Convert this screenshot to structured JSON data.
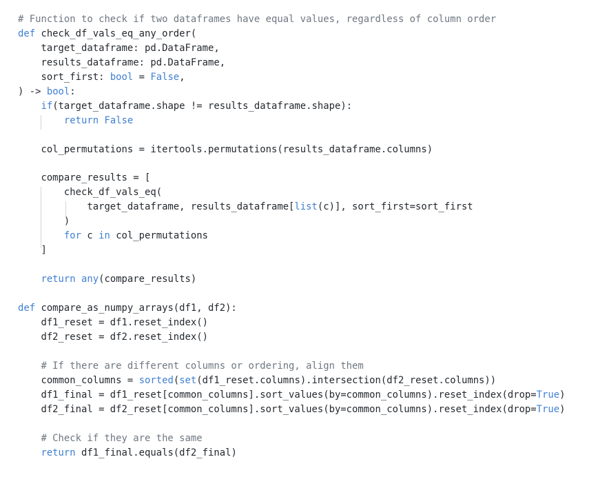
{
  "code": {
    "language": "python",
    "lines": [
      [
        {
          "t": "# Function to check if two dataframes have equal values, regardless of column order",
          "c": "cm"
        }
      ],
      [
        {
          "t": "def",
          "c": "kw"
        },
        {
          "t": " check_df_vals_eq_any_order(",
          "c": "df"
        }
      ],
      [
        {
          "t": "    target_dataframe: pd.DataFrame,",
          "c": "df"
        }
      ],
      [
        {
          "t": "    results_dataframe: pd.DataFrame,",
          "c": "df"
        }
      ],
      [
        {
          "t": "    sort_first: ",
          "c": "df"
        },
        {
          "t": "bool",
          "c": "kw"
        },
        {
          "t": " = ",
          "c": "df"
        },
        {
          "t": "False",
          "c": "kw"
        },
        {
          "t": ",",
          "c": "df"
        }
      ],
      [
        {
          "t": ") -> ",
          "c": "df"
        },
        {
          "t": "bool",
          "c": "kw"
        },
        {
          "t": ":",
          "c": "df"
        }
      ],
      [
        {
          "t": "    ",
          "c": "df"
        },
        {
          "t": "if",
          "c": "kw"
        },
        {
          "t": "(target_dataframe.shape != results_dataframe.shape):",
          "c": "df"
        }
      ],
      [
        {
          "t": "        ",
          "c": "df"
        },
        {
          "t": "return",
          "c": "kw"
        },
        {
          "t": " ",
          "c": "df"
        },
        {
          "t": "False",
          "c": "kw"
        }
      ],
      [],
      [
        {
          "t": "    col_permutations = itertools.permutations(results_dataframe.columns)",
          "c": "df"
        }
      ],
      [],
      [
        {
          "t": "    compare_results = [",
          "c": "df"
        }
      ],
      [
        {
          "t": "        check_df_vals_eq(",
          "c": "df"
        }
      ],
      [
        {
          "t": "            target_dataframe, results_dataframe[",
          "c": "df"
        },
        {
          "t": "list",
          "c": "kw"
        },
        {
          "t": "(c)], sort_first=sort_first",
          "c": "df"
        }
      ],
      [
        {
          "t": "        )",
          "c": "df"
        }
      ],
      [
        {
          "t": "        ",
          "c": "df"
        },
        {
          "t": "for",
          "c": "kw"
        },
        {
          "t": " c ",
          "c": "df"
        },
        {
          "t": "in",
          "c": "kw"
        },
        {
          "t": " col_permutations",
          "c": "df"
        }
      ],
      [
        {
          "t": "    ]",
          "c": "df"
        }
      ],
      [],
      [
        {
          "t": "    ",
          "c": "df"
        },
        {
          "t": "return",
          "c": "kw"
        },
        {
          "t": " ",
          "c": "df"
        },
        {
          "t": "any",
          "c": "kw"
        },
        {
          "t": "(compare_results)",
          "c": "df"
        }
      ],
      [],
      [
        {
          "t": "def",
          "c": "kw"
        },
        {
          "t": " compare_as_numpy_arrays(df1, df2):",
          "c": "df"
        }
      ],
      [
        {
          "t": "    df1_reset = df1.reset_index()",
          "c": "df"
        }
      ],
      [
        {
          "t": "    df2_reset = df2.reset_index()",
          "c": "df"
        }
      ],
      [],
      [
        {
          "t": "    ",
          "c": "df"
        },
        {
          "t": "# If there are different columns or ordering, align them",
          "c": "cm"
        }
      ],
      [
        {
          "t": "    common_columns = ",
          "c": "df"
        },
        {
          "t": "sorted",
          "c": "kw"
        },
        {
          "t": "(",
          "c": "df"
        },
        {
          "t": "set",
          "c": "kw"
        },
        {
          "t": "(df1_reset.columns).intersection(df2_reset.columns))",
          "c": "df"
        }
      ],
      [
        {
          "t": "    df1_final = df1_reset[common_columns].sort_values(by=common_columns).reset_index(drop=",
          "c": "df"
        },
        {
          "t": "True",
          "c": "kw"
        },
        {
          "t": ")",
          "c": "df"
        }
      ],
      [
        {
          "t": "    df2_final = df2_reset[common_columns].sort_values(by=common_columns).reset_index(drop=",
          "c": "df"
        },
        {
          "t": "True",
          "c": "kw"
        },
        {
          "t": ")",
          "c": "df"
        }
      ],
      [],
      [
        {
          "t": "    ",
          "c": "df"
        },
        {
          "t": "# Check if they are the same",
          "c": "cm"
        }
      ],
      [
        {
          "t": "    ",
          "c": "df"
        },
        {
          "t": "return",
          "c": "kw"
        },
        {
          "t": " df1_final.equals(df2_final)",
          "c": "df"
        }
      ]
    ]
  },
  "colors": {
    "keyword": "#3f7fd2",
    "comment": "#6e7781",
    "text": "#24292f",
    "indent_guide": "#d0d7de",
    "background": "#ffffff"
  }
}
